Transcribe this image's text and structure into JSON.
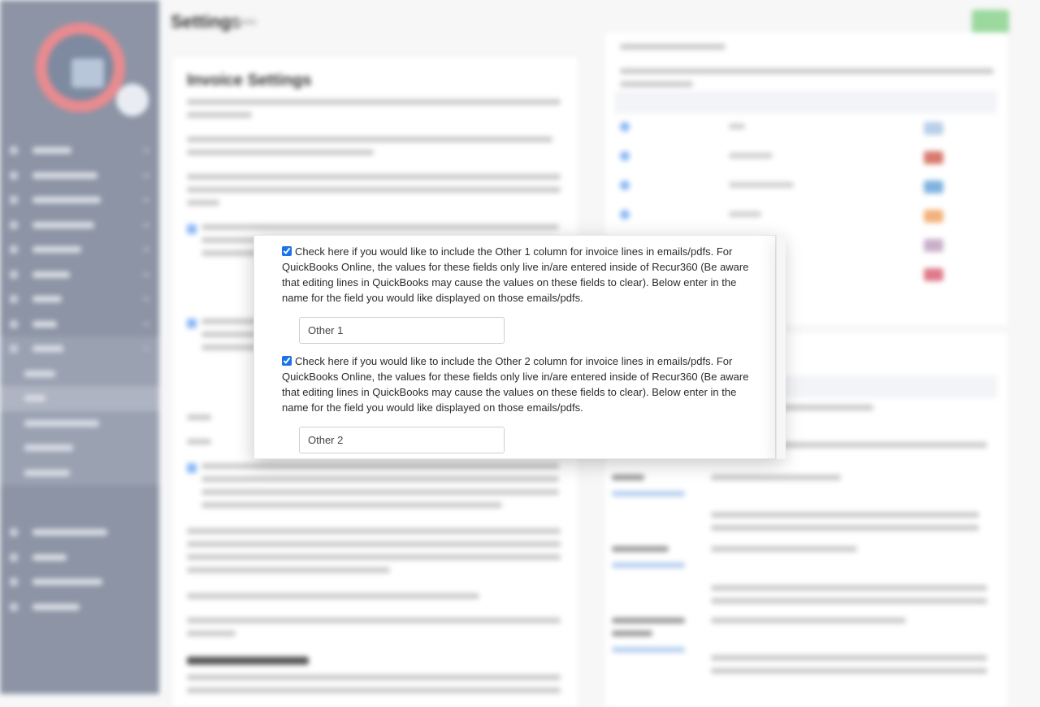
{
  "page": {
    "title": "Settings",
    "save_button_color": "#9bd99e"
  },
  "sidebar": {
    "item_count_top": 9,
    "settings_expanded": true,
    "settings_sub_item_count": 5,
    "active_sub_item_index": 1,
    "bottom_item_count": 4,
    "colors": {
      "background": "#8c94a5",
      "logo_ring": "#e98b8f"
    }
  },
  "invoice_settings": {
    "title": "Invoice Settings"
  },
  "payment_methods": {
    "row_count": 6,
    "card_icon_colors": [
      "#b9cfe9",
      "#d77a6e",
      "#7fb4e0",
      "#f2b27a",
      "#c9b0c8",
      "#e07a8a"
    ]
  },
  "modal": {
    "options": [
      {
        "checked": true,
        "label": "Check here if you would like to include the Other 1 column for invoice lines in emails/pdfs. For QuickBooks Online, the values for these fields only live in/are entered inside of Recur360 (Be aware that editing lines in QuickBooks may cause the values on these fields to clear). Below enter in the name for the field you would like displayed on those emails/pdfs.",
        "field_value": "Other 1"
      },
      {
        "checked": true,
        "label": "Check here if you would like to include the Other 2 column for invoice lines in emails/pdfs. For QuickBooks Online, the values for these fields only live in/are entered inside of Recur360 (Be aware that editing lines in QuickBooks may cause the values on these fields to clear). Below enter in the name for the field you would like displayed on those emails/pdfs.",
        "field_value": "Other 2"
      }
    ],
    "checkbox_color": "#1a73e8"
  }
}
